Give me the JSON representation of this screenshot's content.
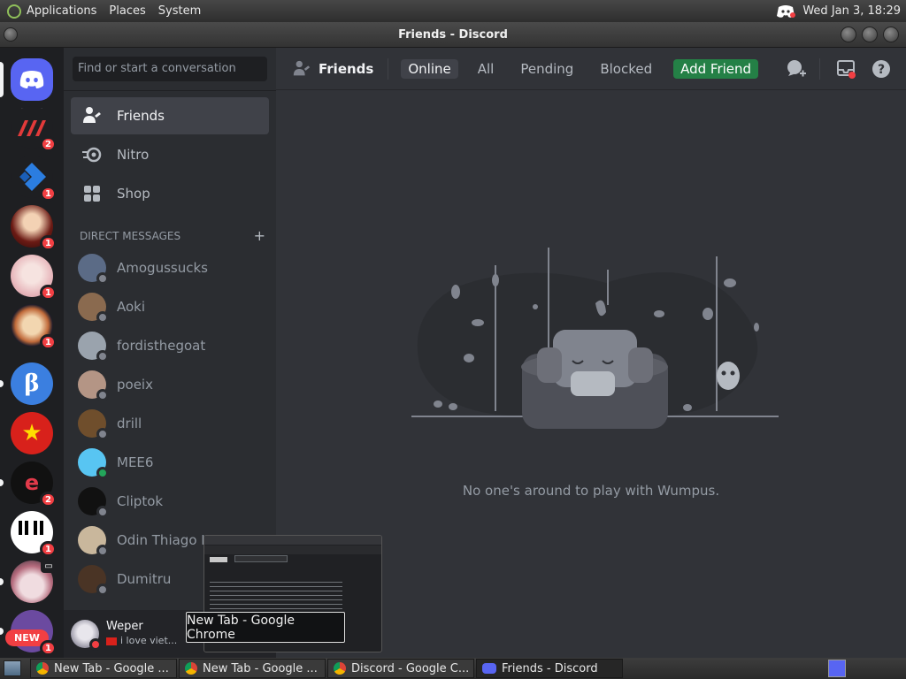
{
  "top_panel": {
    "menus": [
      "Applications",
      "Places",
      "System"
    ],
    "clock": "Wed Jan  3, 18:29"
  },
  "window": {
    "title": "Friends - Discord"
  },
  "servers": [
    {
      "name": "red-logo-server",
      "badge": "2"
    },
    {
      "name": "blue-arrow-server",
      "badge": "1"
    },
    {
      "name": "anime-avatar-server",
      "badge": "1"
    },
    {
      "name": "pink-anime-server",
      "badge": "1"
    },
    {
      "name": "owl-server",
      "badge": "1"
    },
    {
      "name": "beta-server",
      "badge": ""
    },
    {
      "name": "vietnam-flag-server",
      "badge": ""
    },
    {
      "name": "e-server",
      "badge": "2"
    },
    {
      "name": "piano-server",
      "badge": "1"
    },
    {
      "name": "cat-server",
      "badge": ""
    },
    {
      "name": "new-server",
      "badge": "1",
      "label": "NEW"
    }
  ],
  "sidebar": {
    "search_placeholder": "Find or start a conversation",
    "nav": [
      {
        "label": "Friends",
        "icon": "friends-icon"
      },
      {
        "label": "Nitro",
        "icon": "nitro-icon"
      },
      {
        "label": "Shop",
        "icon": "shop-icon"
      }
    ],
    "dm_header": "DIRECT MESSAGES",
    "dm_add": "+",
    "dms": [
      {
        "name": "Amogussucks",
        "status": "offline",
        "color": "#5b6b86"
      },
      {
        "name": "Aoki",
        "status": "offline",
        "color": "#8a6a4f"
      },
      {
        "name": "fordisthegoat",
        "status": "offline",
        "color": "#9aa3ad"
      },
      {
        "name": "poeix",
        "status": "offline",
        "color": "#b49585"
      },
      {
        "name": "drill",
        "status": "offline",
        "color": "#6f4e2c"
      },
      {
        "name": "MEE6",
        "status": "online",
        "color": "#58c5f2"
      },
      {
        "name": "Cliptok",
        "status": "offline",
        "color": "#111111"
      },
      {
        "name": "Odin Thiago Ho",
        "status": "offline",
        "color": "#c9b79c"
      },
      {
        "name": "Dumitru",
        "status": "offline",
        "color": "#4a3425"
      }
    ]
  },
  "user_panel": {
    "name": "Weper",
    "status_text": "i love viet..."
  },
  "main": {
    "header_title": "Friends",
    "tabs": [
      "Online",
      "All",
      "Pending",
      "Blocked"
    ],
    "add_friend": "Add Friend",
    "empty_message": "No one's around to play with Wumpus."
  },
  "tooltip": "New Tab - Google Chrome",
  "taskbar": [
    {
      "label": "New Tab - Google ...",
      "icon": "chrome-icon"
    },
    {
      "label": "New Tab - Google ...",
      "icon": "chrome-icon"
    },
    {
      "label": "Discord - Google C...",
      "icon": "chrome-icon"
    },
    {
      "label": "Friends - Discord",
      "icon": "discord-icon"
    }
  ],
  "colors": {
    "accent": "#5865f2",
    "add_friend": "#248046",
    "badge": "#f23f43",
    "online": "#23a55a"
  }
}
